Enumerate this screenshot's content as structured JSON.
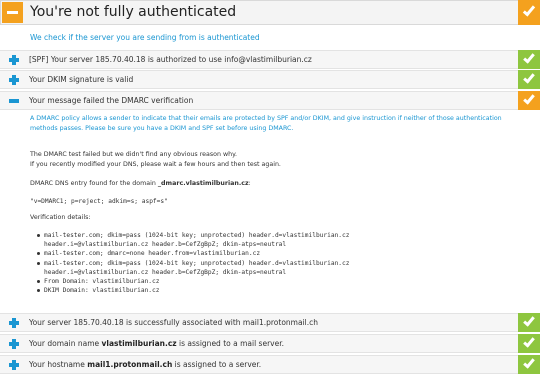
{
  "header": {
    "title": "You're not fully authenticated",
    "subtext": "We check if the server you are sending from is authenticated"
  },
  "rows_top": [
    {
      "label": "[SPF] Your server 185.70.40.18 is authorized to use info@vlastimilburian.cz",
      "status": "pass"
    },
    {
      "label": "Your DKIM signature is valid",
      "status": "pass"
    }
  ],
  "dmarc": {
    "label": "Your message failed the DMARC verification",
    "status": "warning",
    "intro_line1": "A DMARC policy allows a sender to indicate that their emails are protected by SPF and/or DKIM, and give instruction if neither of those authentication",
    "intro_line2": "methods passes. Please be sure you have a DKIM and SPF set before using DMARC.",
    "fail_line1": "The DMARC test failed but we didn't find any obvious reason why.",
    "fail_line2": "If you recently modified your DNS, please wait a few hours and then test again.",
    "dns_prefix": "DMARC DNS entry found for the domain ",
    "dns_domain": "_dmarc.vlastimilburian.cz",
    "dns_suffix": ":",
    "dns_record": "\"v=DMARC1; p=reject; adkim=s; aspf=s\"",
    "verification_heading": "Verification details:",
    "verification_lines": [
      "mail-tester.com; dkim=pass (1024-bit key; unprotected) header.d=vlastimilburian.cz",
      "header.i=@vlastimilburian.cz header.b=CefZgBpZ; dkim-atps=neutral",
      "mail-tester.com; dmarc=none header.from=vlastimilburian.cz",
      "mail-tester.com; dkim=pass (1024-bit key; unprotected) header.d=vlastimilburian.cz",
      "header.i=@vlastimilburian.cz header.b=CefZgBpZ; dkim-atps=neutral",
      "From Domain: vlastimilburian.cz",
      "DKIM Domain: vlastimilburian.cz"
    ]
  },
  "rows_bottom": [
    {
      "label": "Your server 185.70.40.18 is successfully associated with mail1.protonmail.ch",
      "status": "pass"
    },
    {
      "prefix": "Your domain name ",
      "bold": "vlastimilburian.cz",
      "suffix": " is assigned to a mail server.",
      "status": "pass"
    },
    {
      "prefix": "Your hostname ",
      "bold": "mail1.protonmail.ch",
      "suffix": " is assigned to a server.",
      "status": "pass"
    }
  ],
  "colors": {
    "accent_blue": "#1a96d2",
    "pass_green": "#8ec63f",
    "warning_orange": "#f4a11e"
  },
  "icons": {
    "expand": "plus-icon",
    "collapse": "minus-icon",
    "status": "checkmark-icon"
  }
}
